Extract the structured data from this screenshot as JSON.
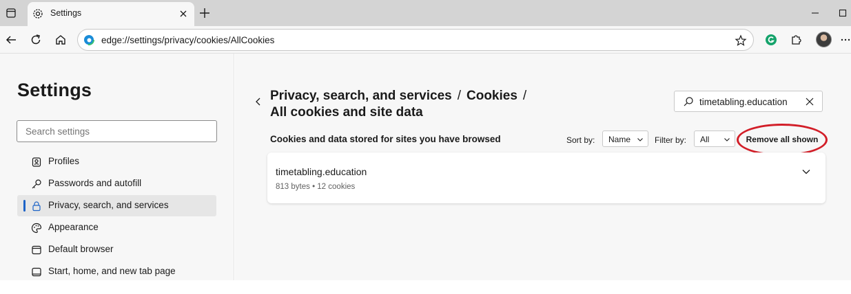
{
  "tab": {
    "title": "Settings"
  },
  "address_bar": {
    "url": "edge://settings/privacy/cookies/AllCookies"
  },
  "sidebar": {
    "title": "Settings",
    "search_placeholder": "Search settings",
    "items": [
      {
        "label": "Profiles",
        "icon": "profile-icon",
        "active": false
      },
      {
        "label": "Passwords and autofill",
        "icon": "key-icon",
        "active": false
      },
      {
        "label": "Privacy, search, and services",
        "icon": "lock-icon",
        "active": true
      },
      {
        "label": "Appearance",
        "icon": "palette-icon",
        "active": false
      },
      {
        "label": "Default browser",
        "icon": "browser-icon",
        "active": false
      },
      {
        "label": "Start, home, and new tab page",
        "icon": "home-tab-icon",
        "active": false
      }
    ]
  },
  "main": {
    "breadcrumb": {
      "part1": "Privacy, search, and services",
      "separator": "/",
      "part2": "Cookies",
      "part3": "All cookies and site data"
    },
    "site_search_value": "timetabling.education",
    "section_title": "Cookies and data stored for sites you have browsed",
    "sort_label": "Sort by:",
    "sort_value": "Name",
    "filter_label": "Filter by:",
    "filter_value": "All",
    "remove_button": "Remove all shown",
    "sites": [
      {
        "name": "timetabling.education",
        "meta": "813 bytes • 12 cookies"
      }
    ]
  },
  "colors": {
    "accent": "#1c63c7",
    "annotation": "#d21e28",
    "tabstrip": "#d4d4d4",
    "page_bg": "#f7f7f7"
  }
}
